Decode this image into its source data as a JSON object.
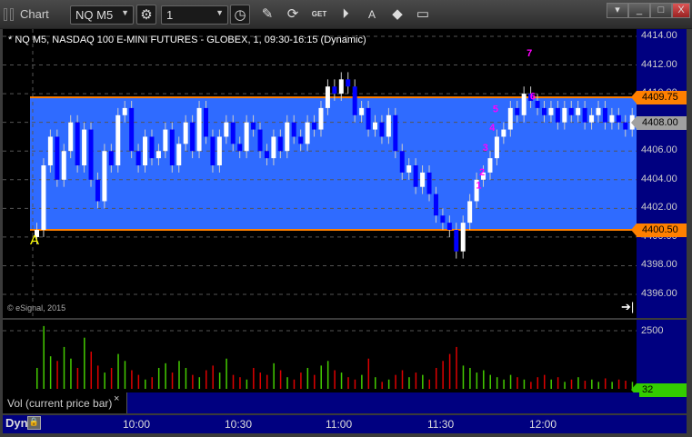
{
  "window": {
    "title": "Chart",
    "symbol": "NQ M5",
    "interval": "1"
  },
  "toolbar": {
    "icons": [
      "settings-icon",
      "clock-icon",
      "pencil-icon",
      "refresh-icon",
      "get-icon",
      "play-icon",
      "alert-icon",
      "link-icon",
      "comment-icon"
    ],
    "get_label": "GET",
    "alert_label": "A"
  },
  "chart": {
    "title": "* NQ M5, NASDAQ 100 E-MINI FUTURES - GLOBEX, 1, 09:30-16:15 (Dynamic)",
    "copyright": "© eSignal, 2015",
    "price_ticks": [
      "4414.00",
      "4412.00",
      "4410.00",
      "4406.00",
      "4404.00",
      "4402.00",
      "4400.00",
      "4398.00",
      "4396.00"
    ],
    "band_high": "4409.75",
    "band_low": "4400.50",
    "last_price": "4408.00",
    "marker_A": "A",
    "colors": {
      "band": "#2f6bff",
      "level": "#ff8000",
      "up": "#ffffff",
      "down": "#0000ff",
      "bg": "#000000",
      "scale": "#000080",
      "last": "#a0a0a0"
    }
  },
  "volume": {
    "label": "Vol (current price bar)",
    "close": "×",
    "tick": "2500",
    "last": "32",
    "last_color": "#33cc00"
  },
  "time_axis": {
    "mode": "Dyn",
    "ticks": [
      "10:00",
      "10:30",
      "11:00",
      "11:30",
      "12:00"
    ]
  },
  "chart_data": {
    "type": "candlestick",
    "bar_minutes": 2,
    "start": "09:30",
    "closes": [
      4400.5,
      4405,
      4407,
      4404,
      4406,
      4408,
      4405,
      4407.5,
      4404,
      4402.5,
      4406,
      4405,
      4408.5,
      4409,
      4406,
      4405,
      4407,
      4405.5,
      4406,
      4407.5,
      4405,
      4406.5,
      4408,
      4406,
      4409,
      4407,
      4405,
      4407,
      4408,
      4406.5,
      4406,
      4408,
      4407.5,
      4406,
      4405.5,
      4407,
      4406,
      4408,
      4407,
      4406.5,
      4408,
      4407.5,
      4409,
      4410.5,
      4410,
      4411,
      4410.5,
      4408.5,
      4409,
      4407.5,
      4408,
      4407,
      4408.5,
      4406,
      4404.5,
      4405,
      4403.5,
      4404.5,
      4403,
      4401.5,
      4401,
      4400.5,
      4399,
      4401,
      4402.5,
      4404,
      4404.5,
      4405.5,
      4407,
      4407.5,
      4409,
      4408.5,
      4410,
      4409.5,
      4409,
      4408.5,
      4409,
      4408,
      4409,
      4408.5,
      4409,
      4408,
      4408.5,
      4409,
      4408,
      4408.5,
      4408,
      4407.5,
      4408.5,
      4408
    ],
    "volumes": [
      900,
      2700,
      1400,
      1200,
      1800,
      1300,
      900,
      2200,
      1600,
      1000,
      700,
      900,
      1500,
      1200,
      800,
      600,
      400,
      500,
      900,
      1100,
      700,
      1200,
      900,
      600,
      500,
      800,
      1000,
      700,
      1300,
      600,
      500,
      400,
      900,
      700,
      600,
      1100,
      800,
      500,
      400,
      700,
      900,
      600,
      1000,
      1200,
      800,
      700,
      500,
      400,
      600,
      1300,
      500,
      300,
      400,
      600,
      800,
      500,
      700,
      600,
      400,
      900,
      1200,
      1500,
      1800,
      1000,
      900,
      700,
      800,
      600,
      500,
      400,
      600,
      500,
      400,
      300,
      500,
      600,
      400,
      500,
      300,
      400,
      500,
      350,
      400,
      300,
      450,
      300,
      400,
      350,
      300,
      32
    ],
    "signals": [
      {
        "label": "1",
        "time": "11:41",
        "price": 4403.4
      },
      {
        "label": "2",
        "time": "11:42",
        "price": 4404.3
      },
      {
        "label": "3",
        "time": "11:43",
        "price": 4406
      },
      {
        "label": "4",
        "time": "11:45",
        "price": 4407.4
      },
      {
        "label": "5",
        "time": "11:46",
        "price": 4408.7
      },
      {
        "label": "6",
        "time": "11:57",
        "price": 4409.6
      },
      {
        "label": "7",
        "time": "11:56",
        "price": 4412.6
      }
    ],
    "ylim": [
      4395,
      4414.7
    ],
    "vol_max": 3000
  }
}
